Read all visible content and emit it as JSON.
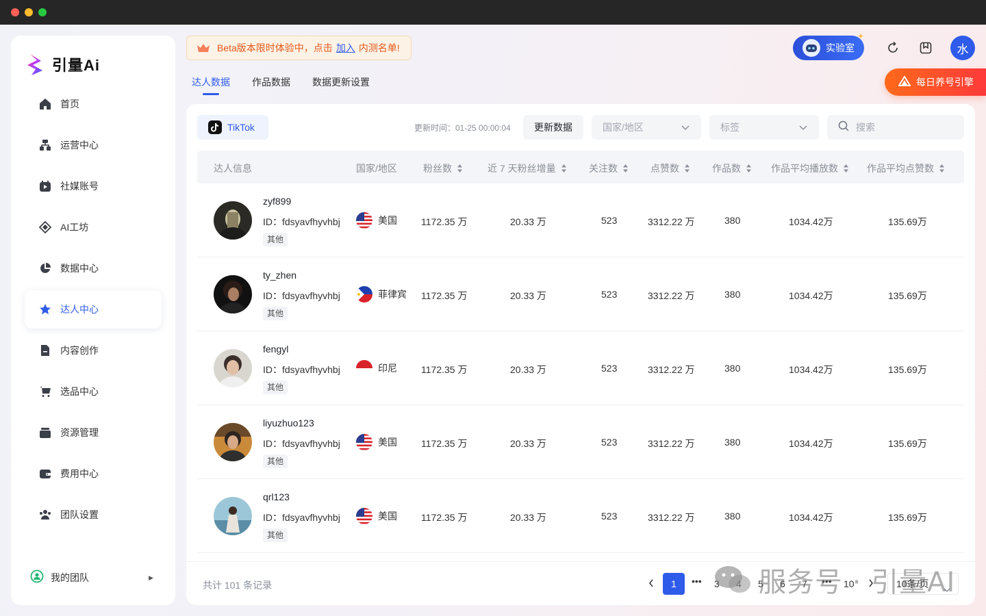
{
  "app": {
    "name": "引量Ai"
  },
  "colors": {
    "accent": "#2f5bea",
    "warning": "#e45a1b",
    "daily": "#ff5a2a"
  },
  "sidebar": {
    "items": [
      {
        "label": "首页",
        "icon": "home-icon"
      },
      {
        "label": "运营中心",
        "icon": "sitemap-icon"
      },
      {
        "label": "社媒账号",
        "icon": "media-account-icon"
      },
      {
        "label": "AI工坊",
        "icon": "ai-workshop-icon"
      },
      {
        "label": "数据中心",
        "icon": "pie-chart-icon"
      },
      {
        "label": "达人中心",
        "icon": "star-icon",
        "active": true
      },
      {
        "label": "内容创作",
        "icon": "document-icon"
      },
      {
        "label": "选品中心",
        "icon": "cart-icon"
      },
      {
        "label": "资源管理",
        "icon": "folder-icon"
      },
      {
        "label": "费用中心",
        "icon": "wallet-icon"
      },
      {
        "label": "团队设置",
        "icon": "team-icon"
      }
    ],
    "team_label": "我的团队"
  },
  "banner": {
    "pre": "Beta版本限时体验中，点击",
    "link": "加入",
    "post": "内测名单!"
  },
  "header": {
    "lab_label": "实验室",
    "avatar_text": "水",
    "daily_label": "每日养号引擎"
  },
  "tabs": [
    "达人数据",
    "作品数据",
    "数据更新设置"
  ],
  "toolbar": {
    "platform": "TikTok",
    "update_time": "更新时间：01-25 00:00:04",
    "update_button": "更新数据",
    "region_placeholder": "国家/地区",
    "tag_placeholder": "标签",
    "search_placeholder": "搜索"
  },
  "table": {
    "headers": {
      "info": "达人信息",
      "country": "国家/地区",
      "fans": "粉丝数",
      "growth7d": "近 7 天粉丝增量",
      "following": "关注数",
      "likes": "点赞数",
      "works": "作品数",
      "avg_plays": "作品平均播放数",
      "avg_likes": "作品平均点赞数"
    },
    "rows": [
      {
        "name": "zyf899",
        "id": "ID：fdsyavfhyvhbj",
        "tag": "其他",
        "country": "美国",
        "flag": "us",
        "fans": "1172.35 万",
        "growth7d": "20.33 万",
        "following": "523",
        "likes": "3312.22 万",
        "works": "380",
        "avg_plays": "1034.42万",
        "avg_likes": "135.69万"
      },
      {
        "name": "ty_zhen",
        "id": "ID：fdsyavfhyvhbj",
        "tag": "其他",
        "country": "菲律宾",
        "flag": "ph",
        "fans": "1172.35 万",
        "growth7d": "20.33 万",
        "following": "523",
        "likes": "3312.22 万",
        "works": "380",
        "avg_plays": "1034.42万",
        "avg_likes": "135.69万"
      },
      {
        "name": "fengyl",
        "id": "ID：fdsyavfhyvhbj",
        "tag": "其他",
        "country": "印尼",
        "flag": "id",
        "fans": "1172.35 万",
        "growth7d": "20.33 万",
        "following": "523",
        "likes": "3312.22 万",
        "works": "380",
        "avg_plays": "1034.42万",
        "avg_likes": "135.69万"
      },
      {
        "name": "liyuzhuo123",
        "id": "ID：fdsyavfhyvhbj",
        "tag": "其他",
        "country": "美国",
        "flag": "us",
        "fans": "1172.35 万",
        "growth7d": "20.33 万",
        "following": "523",
        "likes": "3312.22 万",
        "works": "380",
        "avg_plays": "1034.42万",
        "avg_likes": "135.69万"
      },
      {
        "name": "qrl123",
        "id": "ID：fdsyavfhyvhbj",
        "tag": "其他",
        "country": "美国",
        "flag": "us",
        "fans": "1172.35 万",
        "growth7d": "20.33 万",
        "following": "523",
        "likes": "3312.22 万",
        "works": "380",
        "avg_plays": "1034.42万",
        "avg_likes": "135.69万"
      }
    ]
  },
  "pagination": {
    "total": "共计 101 条记录",
    "current": "1",
    "pages": [
      "3",
      "4",
      "5",
      "6",
      "7",
      "10"
    ],
    "page_size": "10条/页"
  },
  "watermark": "服务号 · 引量AI"
}
